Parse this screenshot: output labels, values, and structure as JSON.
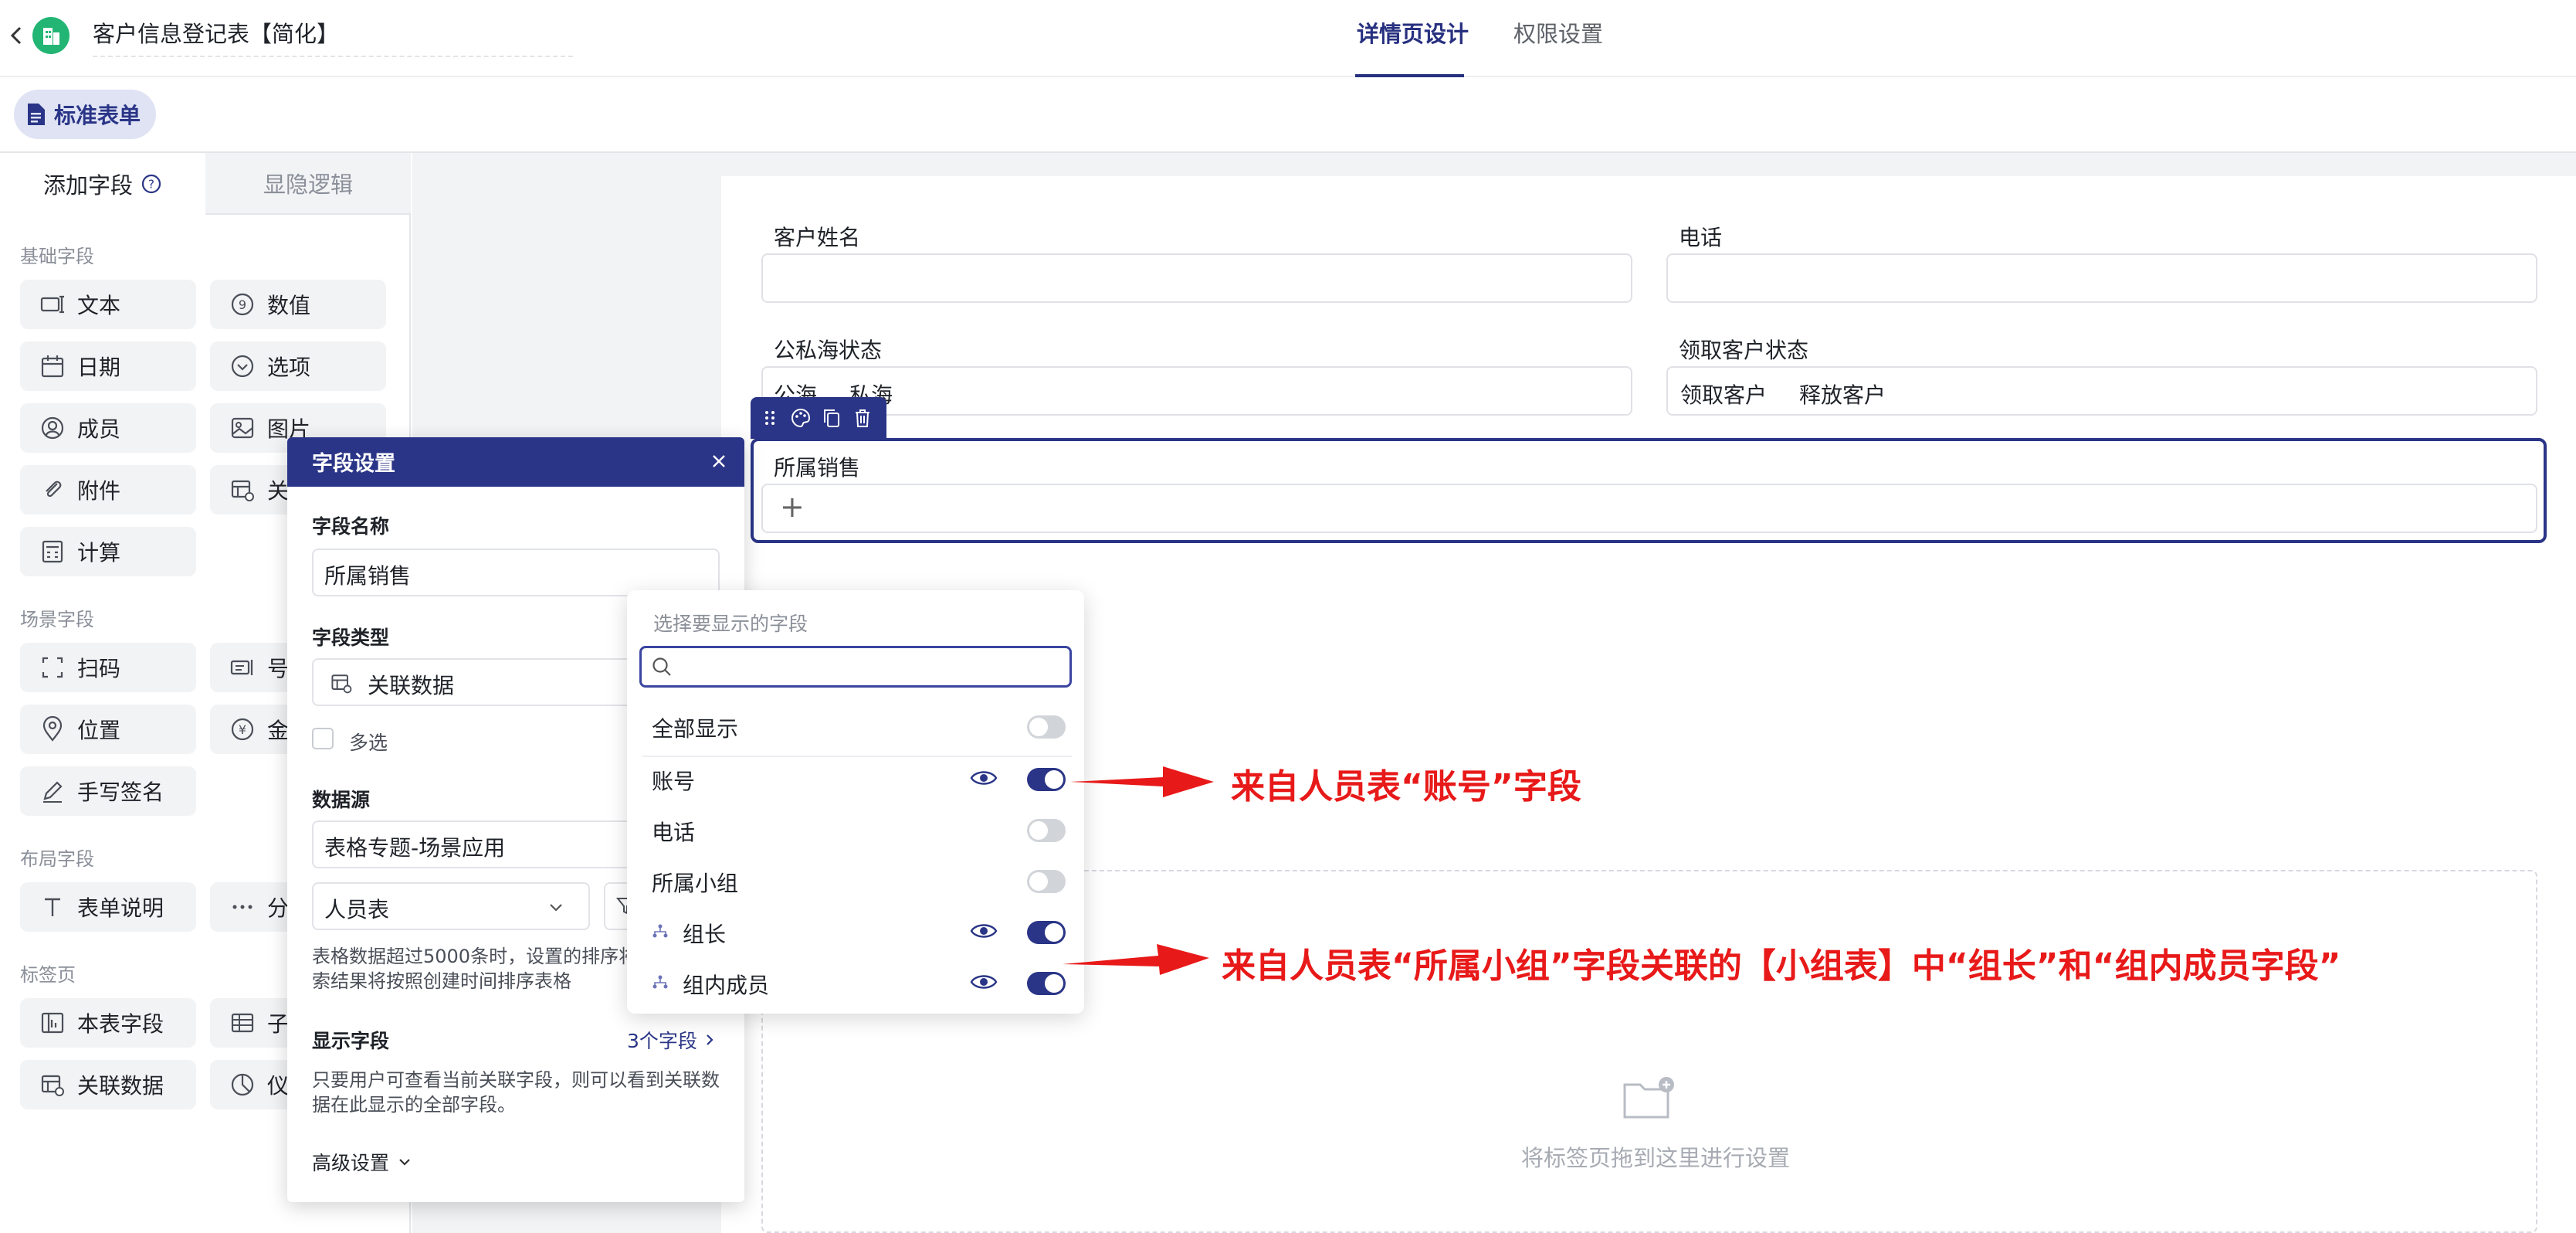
{
  "header": {
    "title": "客户信息登记表【简化】",
    "tabs": [
      {
        "label": "详情页设计",
        "active": true
      },
      {
        "label": "权限设置",
        "active": false
      }
    ],
    "std_form_label": "标准表单"
  },
  "left_panel": {
    "tab_add": "添加字段",
    "tab_logic": "显隐逻辑",
    "sections": {
      "basic": "基础字段",
      "scene": "场景字段",
      "layout": "布局字段",
      "tabs": "标签页"
    },
    "fields": {
      "text": "文本",
      "number": "数值",
      "date": "日期",
      "option": "选项",
      "member": "成员",
      "image": "图片",
      "attachment": "附件",
      "relation_partial": "关",
      "calc": "计算",
      "scan": "扫码",
      "serial_partial": "号",
      "location": "位置",
      "amount_partial": "金",
      "signature": "手写签名",
      "form_desc": "表单说明",
      "split_partial": "分",
      "this_table_field": "本表字段",
      "sub_partial": "子",
      "relation_data": "关联数据",
      "dashboard_partial": "仪"
    }
  },
  "form": {
    "name_label": "客户姓名",
    "phone_label": "电话",
    "sea_label": "公私海状态",
    "sea_options": [
      "公海",
      "私海"
    ],
    "claim_label": "领取客户状态",
    "claim_options": [
      "领取客户",
      "释放客户"
    ],
    "sales_label": "所属销售",
    "plus": "+",
    "drop_text": "将标签页拖到这里进行设置"
  },
  "settings": {
    "title": "字段设置",
    "name_label": "字段名称",
    "name_value": "所属销售",
    "type_label": "字段类型",
    "type_value": "关联数据",
    "multi_label": "多选",
    "source_label": "数据源",
    "source_value": "表格专题-场景应用",
    "table_value": "人员表",
    "hint": "表格数据超过5000条时，设置的排序将失效，搜索结果将按照创建时间排序表格",
    "display_label": "显示字段",
    "display_count": "3个字段",
    "display_hint": "只要用户可查看当前关联字段，则可以看到关联数据在此显示的全部字段。",
    "advanced": "高级设置"
  },
  "dropdown": {
    "hint": "选择要显示的字段",
    "search_placeholder": "",
    "rows": [
      {
        "label": "全部显示",
        "on": false,
        "eye": false,
        "link": false
      },
      {
        "label": "账号",
        "on": true,
        "eye": true,
        "link": false
      },
      {
        "label": "电话",
        "on": false,
        "eye": false,
        "link": false
      },
      {
        "label": "所属小组",
        "on": false,
        "eye": false,
        "link": false
      },
      {
        "label": "组长",
        "on": true,
        "eye": true,
        "link": true
      },
      {
        "label": "组内成员",
        "on": true,
        "eye": true,
        "link": true
      }
    ]
  },
  "annotations": {
    "account": "来自人员表“账号”字段",
    "group": "来自人员表“所属小组”字段关联的【小组表】中“组长”和“组内成员字段”"
  },
  "colors": {
    "primary": "#2a3587",
    "accent_green": "#22b573",
    "annotation": "#e81919"
  }
}
